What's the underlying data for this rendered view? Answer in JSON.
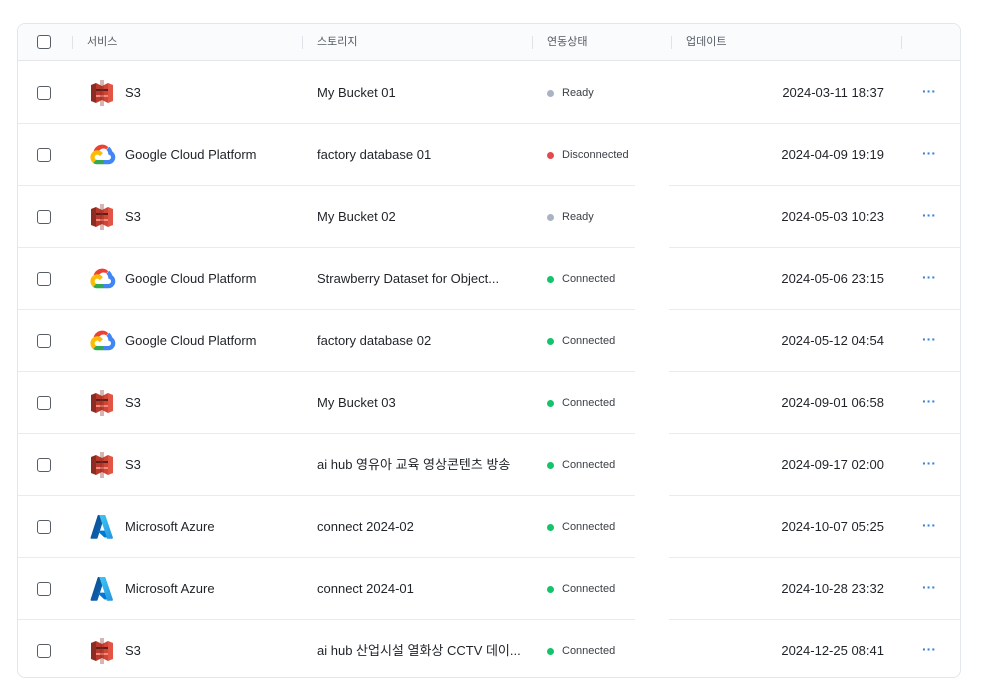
{
  "header": {
    "service": "서비스",
    "storage": "스토리지",
    "status": "연동상태",
    "updated": "업데이트"
  },
  "colors": {
    "ready": "#a9b3c2",
    "disconnected": "#e5484d",
    "connected": "#12c46b",
    "more": "#3b82d6"
  },
  "rows": [
    {
      "service": "S3",
      "service_icon": "aws-s3-icon",
      "storage": "My Bucket 01",
      "status": "Ready",
      "status_kind": "ready",
      "updated": "2024-03-11 18:37"
    },
    {
      "service": "Google Cloud Platform",
      "service_icon": "google-cloud-icon",
      "storage": "factory database 01",
      "status": "Disconnected",
      "status_kind": "disconnected",
      "updated": "2024-04-09 19:19"
    },
    {
      "service": "S3",
      "service_icon": "aws-s3-icon",
      "storage": "My Bucket 02",
      "status": "Ready",
      "status_kind": "ready",
      "updated": "2024-05-03 10:23"
    },
    {
      "service": "Google Cloud Platform",
      "service_icon": "google-cloud-icon",
      "storage": "Strawberry Dataset for Object...",
      "status": "Connected",
      "status_kind": "connected",
      "updated": "2024-05-06 23:15"
    },
    {
      "service": "Google Cloud Platform",
      "service_icon": "google-cloud-icon",
      "storage": "factory database 02",
      "status": "Connected",
      "status_kind": "connected",
      "updated": "2024-05-12 04:54"
    },
    {
      "service": "S3",
      "service_icon": "aws-s3-icon",
      "storage": "My Bucket 03",
      "status": "Connected",
      "status_kind": "connected",
      "updated": "2024-09-01 06:58"
    },
    {
      "service": "S3",
      "service_icon": "aws-s3-icon",
      "storage": "ai hub 영유아 교육 영상콘텐츠 방송",
      "status": "Connected",
      "status_kind": "connected",
      "updated": "2024-09-17 02:00"
    },
    {
      "service": "Microsoft Azure",
      "service_icon": "azure-icon",
      "storage": "connect 2024-02",
      "status": "Connected",
      "status_kind": "connected",
      "updated": "2024-10-07 05:25"
    },
    {
      "service": "Microsoft Azure",
      "service_icon": "azure-icon",
      "storage": "connect 2024-01",
      "status": "Connected",
      "status_kind": "connected",
      "updated": "2024-10-28 23:32"
    },
    {
      "service": "S3",
      "service_icon": "aws-s3-icon",
      "storage": "ai hub 산업시설 열화상 CCTV 데이...",
      "status": "Connected",
      "status_kind": "connected",
      "updated": "2024-12-25 08:41"
    }
  ],
  "more_label": "···"
}
